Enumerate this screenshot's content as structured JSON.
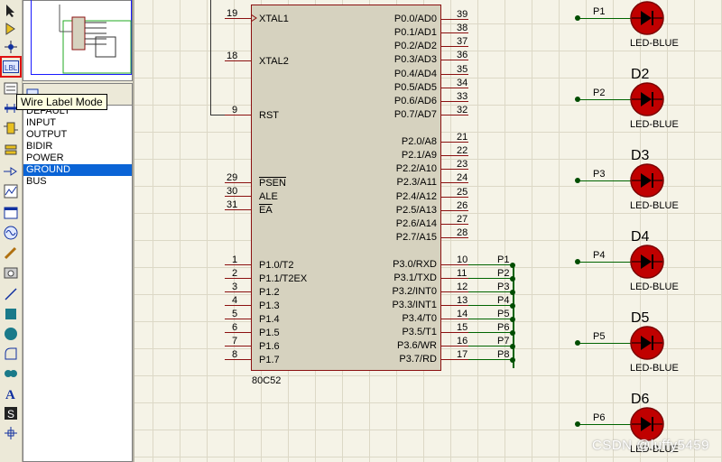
{
  "tooltip": "Wire Label Mode",
  "picker": {
    "items": [
      "DEFAULT",
      "INPUT",
      "OUTPUT",
      "BIDIR",
      "POWER",
      "GROUND",
      "BUS"
    ],
    "selected": "GROUND"
  },
  "chip": {
    "name": "80C52",
    "left_pins": [
      {
        "num": "19",
        "label": "XTAL1"
      },
      {
        "num": "18",
        "label": "XTAL2"
      },
      {
        "num": "9",
        "label": "RST"
      },
      {
        "num": "29",
        "label": "PSEN"
      },
      {
        "num": "30",
        "label": "ALE"
      },
      {
        "num": "31",
        "label": "EA"
      },
      {
        "num": "1",
        "label": "P1.0/T2"
      },
      {
        "num": "2",
        "label": "P1.1/T2EX"
      },
      {
        "num": "3",
        "label": "P1.2"
      },
      {
        "num": "4",
        "label": "P1.3"
      },
      {
        "num": "5",
        "label": "P1.4"
      },
      {
        "num": "6",
        "label": "P1.5"
      },
      {
        "num": "7",
        "label": "P1.6"
      },
      {
        "num": "8",
        "label": "P1.7"
      }
    ],
    "right_pins": [
      {
        "num": "39",
        "label": "P0.0/AD0"
      },
      {
        "num": "38",
        "label": "P0.1/AD1"
      },
      {
        "num": "37",
        "label": "P0.2/AD2"
      },
      {
        "num": "36",
        "label": "P0.3/AD3"
      },
      {
        "num": "35",
        "label": "P0.4/AD4"
      },
      {
        "num": "34",
        "label": "P0.5/AD5"
      },
      {
        "num": "33",
        "label": "P0.6/AD6"
      },
      {
        "num": "32",
        "label": "P0.7/AD7"
      },
      {
        "num": "21",
        "label": "P2.0/A8"
      },
      {
        "num": "22",
        "label": "P2.1/A9"
      },
      {
        "num": "23",
        "label": "P2.2/A10"
      },
      {
        "num": "24",
        "label": "P2.3/A11"
      },
      {
        "num": "25",
        "label": "P2.4/A12"
      },
      {
        "num": "26",
        "label": "P2.5/A13"
      },
      {
        "num": "27",
        "label": "P2.6/A14"
      },
      {
        "num": "28",
        "label": "P2.7/A15"
      },
      {
        "num": "10",
        "label": "P3.0/RXD"
      },
      {
        "num": "11",
        "label": "P3.1/TXD"
      },
      {
        "num": "12",
        "label": "P3.2/INT0"
      },
      {
        "num": "13",
        "label": "P3.3/INT1"
      },
      {
        "num": "14",
        "label": "P3.4/T0"
      },
      {
        "num": "15",
        "label": "P3.5/T1"
      },
      {
        "num": "16",
        "label": "P3.6/WR"
      },
      {
        "num": "17",
        "label": "P3.7/RD"
      }
    ]
  },
  "p3_nets": [
    "P1",
    "P2",
    "P3",
    "P4",
    "P5",
    "P6",
    "P7",
    "P8"
  ],
  "leds": [
    {
      "ref": "",
      "net": "P1",
      "type": "LED-BLUE"
    },
    {
      "ref": "D2",
      "net": "P2",
      "type": "LED-BLUE"
    },
    {
      "ref": "D3",
      "net": "P3",
      "type": "LED-BLUE"
    },
    {
      "ref": "D4",
      "net": "P4",
      "type": "LED-BLUE"
    },
    {
      "ref": "D5",
      "net": "P5",
      "type": "LED-BLUE"
    },
    {
      "ref": "D6",
      "net": "P6",
      "type": "LED-BLUE"
    }
  ],
  "watermark": "CSDN @luffy5459",
  "colors": {
    "wire": "#006400",
    "component": "#8b1010",
    "chip_fill": "#d6d2bf",
    "grid": "#dcd8c6",
    "selection": "#0a64d6"
  }
}
